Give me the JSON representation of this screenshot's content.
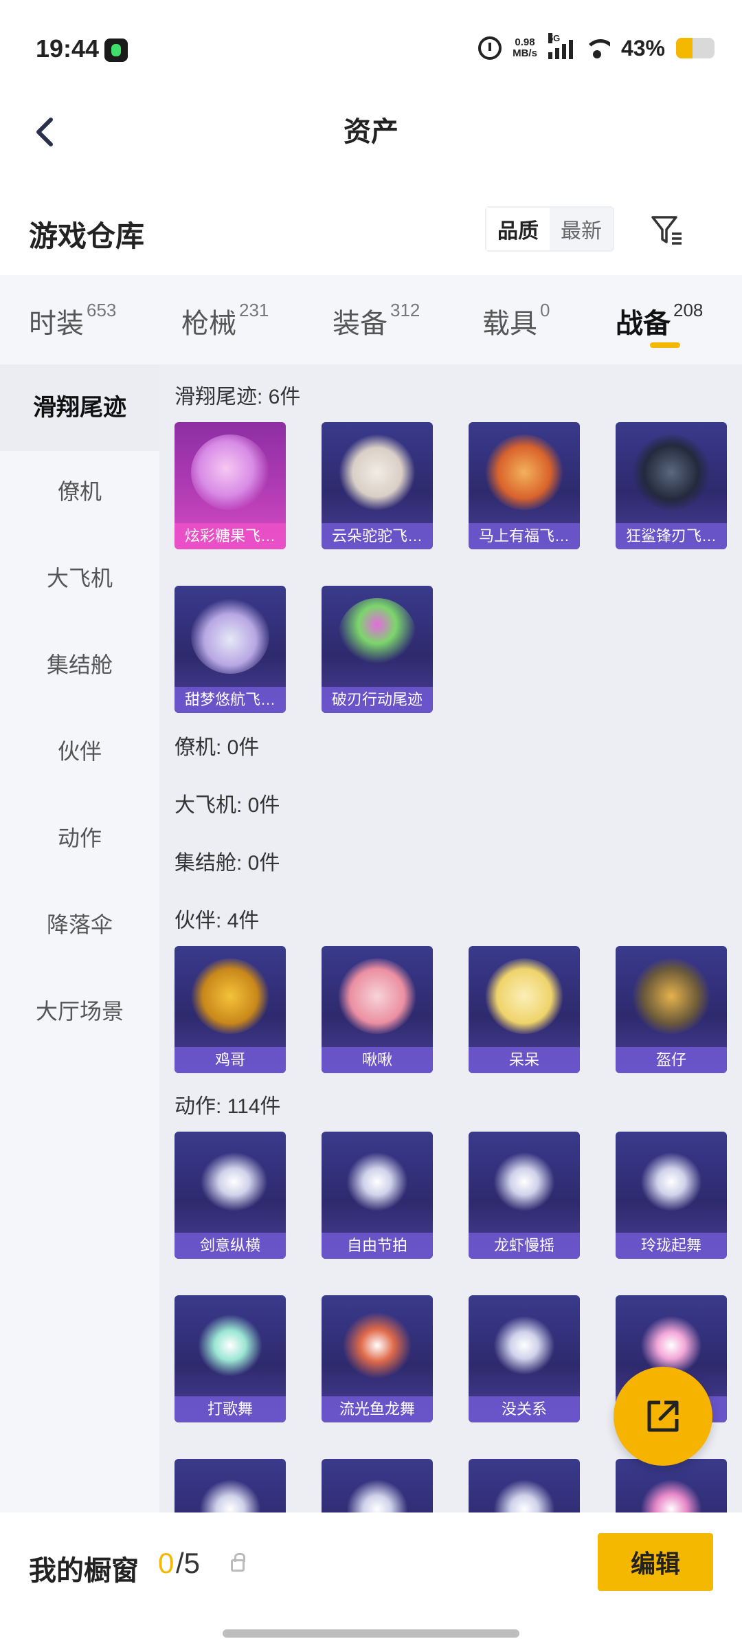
{
  "status_bar": {
    "time": "19:44",
    "net_speed_value": "0.98",
    "net_speed_unit": "MB/s",
    "network": "5G",
    "battery": "43%",
    "battery_level": 0.43,
    "icons": [
      "alarm-icon",
      "signal-icon",
      "wifi-icon",
      "battery-icon"
    ]
  },
  "nav": {
    "title": "资产",
    "back_icon": "chevron-left-icon"
  },
  "warehouse": {
    "title": "游戏仓库",
    "sort_options": [
      "品质",
      "最新"
    ],
    "sort_selected": "品质",
    "filter_icon": "filter-icon"
  },
  "tabs": [
    {
      "label": "时装",
      "count": "653"
    },
    {
      "label": "枪械",
      "count": "231"
    },
    {
      "label": "装备",
      "count": "312"
    },
    {
      "label": "载具",
      "count": "0"
    },
    {
      "label": "战备",
      "count": "208",
      "active": true
    }
  ],
  "sidebar": {
    "items": [
      "滑翔尾迹",
      "僚机",
      "大飞机",
      "集结舱",
      "伙伴",
      "动作",
      "降落伞",
      "大厅场景"
    ],
    "active": "滑翔尾迹"
  },
  "sections": {
    "glide": {
      "title": "滑翔尾迹: 6件",
      "items": [
        "炫彩糖果飞…",
        "云朵驼驼飞…",
        "马上有福飞…",
        "狂鲨锋刃飞…",
        "甜梦悠航飞…",
        "破刃行动尾迹"
      ]
    },
    "wingman": {
      "title": "僚机: 0件"
    },
    "plane": {
      "title": "大飞机: 0件"
    },
    "pod": {
      "title": "集结舱: 0件"
    },
    "partner": {
      "title": "伙伴: 4件",
      "items": [
        "鸡哥",
        "啾啾",
        "呆呆",
        "盔仔"
      ]
    },
    "emote": {
      "title": "动作: 114件",
      "items": [
        "剑意纵横",
        "自由节拍",
        "龙虾慢摇",
        "玲珑起舞",
        "打歌舞",
        "流光鱼龙舞",
        "没关系",
        ""
      ]
    }
  },
  "fab_icon": "share-out-icon",
  "footer": {
    "label": "我的橱窗",
    "current": "0",
    "total": "/5",
    "lock_icon": "lock-icon",
    "edit_label": "编辑"
  },
  "colors": {
    "accent": "#f5b800",
    "card_bg": "#2e2a6e",
    "card_caption": "#7058d2",
    "highlight_card": "#d94cc4"
  }
}
